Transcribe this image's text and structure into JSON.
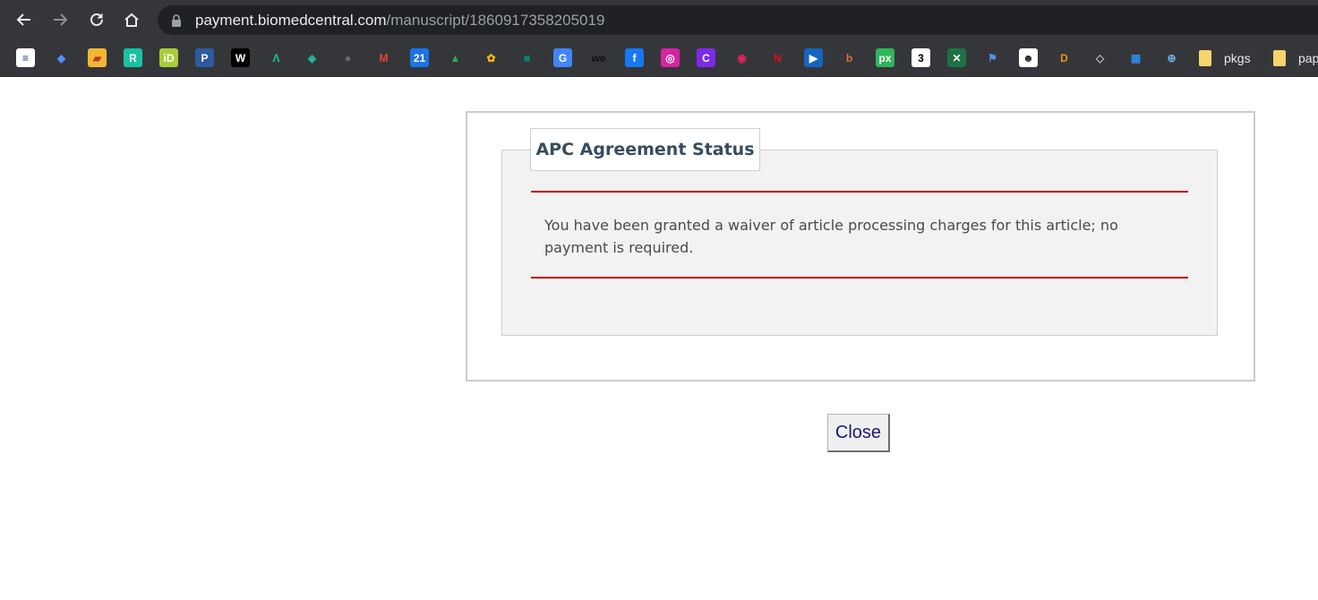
{
  "browser": {
    "url_host": "payment.biomedcentral.com",
    "url_path": "/manuscript/1860917358205019",
    "nav_icons": [
      "back-icon",
      "forward-icon",
      "reload-icon",
      "home-icon",
      "lock-icon"
    ],
    "bookmark_folders": [
      {
        "label": "pkgs"
      },
      {
        "label": "pap"
      }
    ],
    "bookmark_icons": [
      {
        "name": "stack-icon",
        "glyph": "≡",
        "bg": "#ffffff",
        "fg": "#1b3f8b"
      },
      {
        "name": "scholar-icon",
        "glyph": "◆",
        "bg": "transparent",
        "fg": "#4f8ff7"
      },
      {
        "name": "zotero-icon",
        "glyph": "▰",
        "bg": "#f2b632",
        "fg": "#c0392b"
      },
      {
        "name": "researchgate-icon",
        "glyph": "R",
        "bg": "#16c2a5",
        "fg": "#ffffff"
      },
      {
        "name": "orcid-icon",
        "glyph": "iD",
        "bg": "#a6ce39",
        "fg": "#ffffff"
      },
      {
        "name": "pubpeer-icon",
        "glyph": "P",
        "bg": "#2d5aa0",
        "fg": "#ffffff"
      },
      {
        "name": "wordpress-icon",
        "glyph": "W",
        "bg": "#000000",
        "fg": "#ffffff"
      },
      {
        "name": "altmetric-icon",
        "glyph": "Λ",
        "bg": "transparent",
        "fg": "#19c6a0"
      },
      {
        "name": "diamond-icon",
        "glyph": "◆",
        "bg": "transparent",
        "fg": "#1fb59a"
      },
      {
        "name": "globe-icon",
        "glyph": "●",
        "bg": "transparent",
        "fg": "#6b6b6b"
      },
      {
        "name": "gmail-icon",
        "glyph": "M",
        "bg": "transparent",
        "fg": "#ea4335"
      },
      {
        "name": "calendar-icon",
        "glyph": "21",
        "bg": "#1a73e8",
        "fg": "#ffffff"
      },
      {
        "name": "drive-icon",
        "glyph": "▲",
        "bg": "transparent",
        "fg": "#34a853"
      },
      {
        "name": "photos-icon",
        "glyph": "✿",
        "bg": "transparent",
        "fg": "#fbbc04"
      },
      {
        "name": "meet-icon",
        "glyph": "■",
        "bg": "transparent",
        "fg": "#00897b"
      },
      {
        "name": "translate-icon",
        "glyph": "G",
        "bg": "#4285f4",
        "fg": "#ffffff"
      },
      {
        "name": "we-icon",
        "glyph": "we",
        "bg": "transparent",
        "fg": "#111111"
      },
      {
        "name": "facebook-icon",
        "glyph": "f",
        "bg": "#1877f2",
        "fg": "#ffffff"
      },
      {
        "name": "instagram-icon",
        "glyph": "◎",
        "bg": "#d6249f",
        "fg": "#ffffff"
      },
      {
        "name": "canva-icon",
        "glyph": "C",
        "bg": "#7d2ae8",
        "fg": "#ffffff"
      },
      {
        "name": "target-icon",
        "glyph": "◉",
        "bg": "transparent",
        "fg": "#e0245e"
      },
      {
        "name": "netflix-icon",
        "glyph": "N",
        "bg": "transparent",
        "fg": "#e50914"
      },
      {
        "name": "play-icon",
        "glyph": "▶",
        "bg": "#1565c0",
        "fg": "#ffffff"
      },
      {
        "name": "b-circle-icon",
        "glyph": "b",
        "bg": "transparent",
        "fg": "#e06b2d"
      },
      {
        "name": "px-icon",
        "glyph": "px",
        "bg": "#2fb55b",
        "fg": "#ffffff"
      },
      {
        "name": "three-icon",
        "glyph": "3",
        "bg": "#ffffff",
        "fg": "#000000"
      },
      {
        "name": "excel-icon",
        "glyph": "✕",
        "bg": "#1e7145",
        "fg": "#ffffff"
      },
      {
        "name": "flag-icon",
        "glyph": "⚑",
        "bg": "transparent",
        "fg": "#5b8cf6"
      },
      {
        "name": "avatar-bookmark-icon",
        "glyph": "☻",
        "bg": "#ffffff",
        "fg": "#222222"
      },
      {
        "name": "d-icon",
        "glyph": "D",
        "bg": "transparent",
        "fg": "#f29111"
      },
      {
        "name": "layers-icon",
        "glyph": "◇",
        "bg": "transparent",
        "fg": "#b0b6bd"
      },
      {
        "name": "layout-icon",
        "glyph": "▦",
        "bg": "transparent",
        "fg": "#2b8be6"
      },
      {
        "name": "crosshair-globe-icon",
        "glyph": "⊕",
        "bg": "transparent",
        "fg": "#6fb3f0"
      }
    ]
  },
  "dialog": {
    "title": "APC Agreement Status",
    "message": "You have been granted a waiver of article processing charges for this article; no payment is required.",
    "close_label": "Close"
  }
}
